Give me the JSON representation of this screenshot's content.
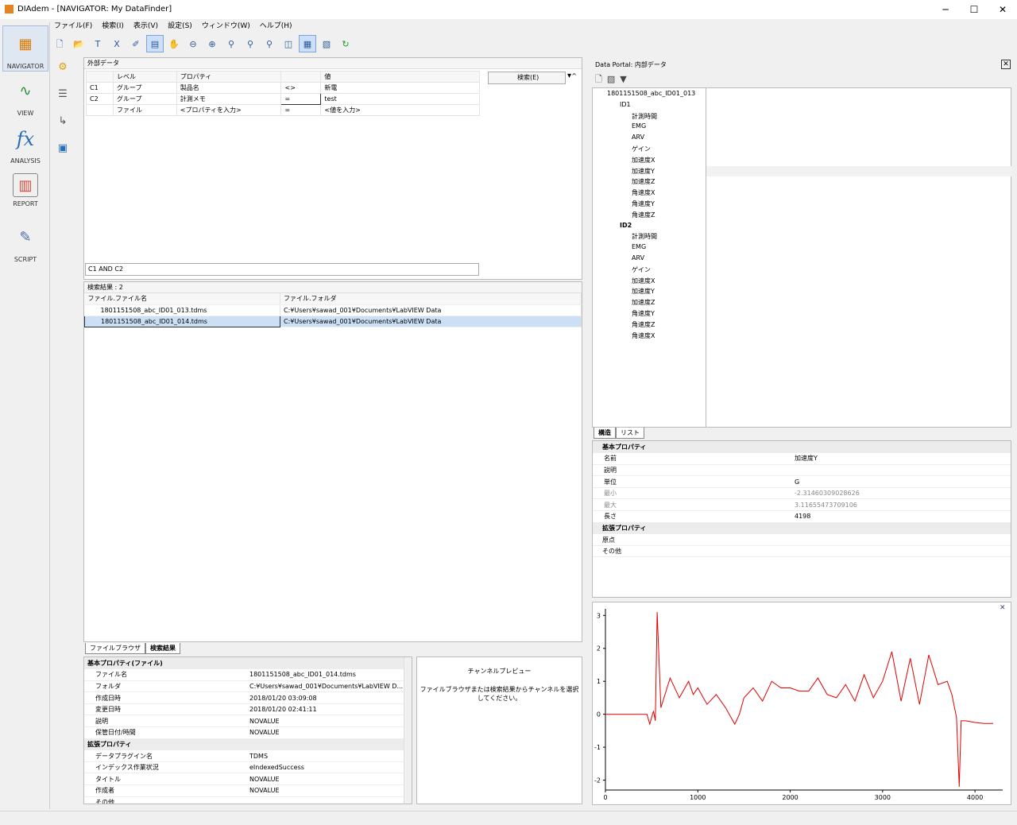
{
  "window": {
    "title": "DIAdem - [NAVIGATOR:  My DataFinder]",
    "min": "─",
    "max": "☐",
    "close": "✕"
  },
  "menu": [
    "ファイル(F)",
    "検索(I)",
    "表示(V)",
    "設定(S)",
    "ウィンドウ(W)",
    "ヘルプ(H)"
  ],
  "sidebar": [
    {
      "label": "NAVIGATOR",
      "icon": "navigator-icon"
    },
    {
      "label": "VIEW",
      "icon": "view-icon"
    },
    {
      "label": "ANALYSIS",
      "icon": "analysis-icon"
    },
    {
      "label": "REPORT",
      "icon": "report-icon"
    },
    {
      "label": "SCRIPT",
      "icon": "script-icon"
    }
  ],
  "query": {
    "title": "外部データ",
    "headers": [
      "レベル",
      "プロパティ",
      "",
      "値"
    ],
    "rows": [
      [
        "C1",
        "グループ",
        "製品名",
        "<>",
        "新電"
      ],
      [
        "C2",
        "グループ",
        "計測メモ",
        "=",
        "test"
      ],
      [
        "",
        "ファイル",
        "<プロパティを入力>",
        "=",
        "<値を入力>"
      ]
    ],
    "search_label": "検索(E)",
    "condition": "C1 AND C2"
  },
  "results": {
    "title": "検索結果 : 2",
    "headers": [
      "ファイル.ファイル名",
      "ファイル.フォルダ"
    ],
    "rows": [
      [
        "1801151508_abc_ID01_013.tdms",
        "C:¥Users¥sawad_001¥Documents¥LabVIEW Data"
      ],
      [
        "1801151508_abc_ID01_014.tdms",
        "C:¥Users¥sawad_001¥Documents¥LabVIEW Data"
      ]
    ],
    "tabs": [
      "ファイルブラウザ",
      "検索結果"
    ]
  },
  "file_props": {
    "sections": [
      {
        "name": "基本プロパティ(ファイル)",
        "items": [
          [
            "ファイル名",
            "1801151508_abc_ID01_014.tdms"
          ],
          [
            "フォルダ",
            "C:¥Users¥sawad_001¥Documents¥LabVIEW D..."
          ],
          [
            "作成日時",
            "2018/01/20 03:09:08"
          ],
          [
            "変更日時",
            "2018/01/20 02:41:11"
          ],
          [
            "説明",
            "NOVALUE"
          ],
          [
            "保管日付/時間",
            "NOVALUE"
          ]
        ]
      },
      {
        "name": "拡張プロパティ",
        "items": [
          [
            "データプラグイン名",
            "TDMS"
          ],
          [
            "インデックス作業状況",
            "eIndexedSuccess"
          ],
          [
            "タイトル",
            "NOVALUE"
          ],
          [
            "作成者",
            "NOVALUE"
          ],
          [
            "その他",
            ""
          ]
        ]
      }
    ]
  },
  "preview": {
    "title": "チャンネルプレビュー",
    "text": "ファイルブラウザまたは検索結果からチャンネルを選択してください。"
  },
  "portal": {
    "title": "Data Portal: 内部データ",
    "root": "1801151508_abc_ID01_013",
    "groups": [
      {
        "name": "ID1",
        "channels": [
          "計測時間",
          "EMG",
          "ARV",
          "ゲイン",
          "加速度X",
          "加速度Y",
          "加速度Z",
          "角速度X",
          "角速度Y",
          "角速度Z"
        ]
      },
      {
        "name": "ID2",
        "channels": [
          "計測時間",
          "EMG",
          "ARV",
          "ゲイン",
          "加速度X",
          "加速度Y",
          "加速度Z",
          "角速度Y",
          "角速度Z",
          "角速度X"
        ]
      }
    ],
    "tabs": [
      "構造",
      "リスト"
    ]
  },
  "channel_props": {
    "basic": "基本プロパティ",
    "items": [
      [
        "名前",
        "加速度Y"
      ],
      [
        "説明",
        ""
      ],
      [
        "単位",
        "G"
      ],
      [
        "最小",
        "-2.31460309028626"
      ],
      [
        "最大",
        "3.11655473709106"
      ],
      [
        "長さ",
        "4198"
      ]
    ],
    "ext": "拡張プロパティ",
    "ext_items": [
      "原点",
      "その他"
    ]
  },
  "chart_data": {
    "type": "line",
    "series": [
      {
        "color": "#e00000",
        "x": [
          0,
          450,
          480,
          500,
          520,
          540,
          560,
          600,
          700,
          800,
          900,
          950,
          1000,
          1100,
          1200,
          1300,
          1400,
          1450,
          1500,
          1600,
          1700,
          1800,
          1900,
          2000,
          2100,
          2200,
          2300,
          2400,
          2500,
          2600,
          2700,
          2800,
          2900,
          3000,
          3100,
          3200,
          3300,
          3400,
          3500,
          3600,
          3700,
          3750,
          3800,
          3830,
          3850,
          3900,
          4000,
          4100,
          4198
        ],
        "y": [
          0,
          0,
          -0.3,
          -0.1,
          0.1,
          -0.2,
          3.1,
          0.2,
          1.1,
          0.5,
          1.0,
          0.6,
          0.8,
          0.3,
          0.6,
          0.2,
          -0.3,
          0.0,
          0.5,
          0.8,
          0.4,
          1.0,
          0.8,
          0.8,
          0.7,
          0.7,
          1.1,
          0.6,
          0.5,
          0.9,
          0.4,
          1.2,
          0.5,
          1.0,
          1.9,
          0.4,
          1.7,
          0.3,
          1.8,
          0.9,
          1.0,
          0.6,
          -0.1,
          -2.2,
          -0.2,
          -0.2,
          -0.25,
          -0.28,
          -0.28
        ]
      }
    ],
    "xlim": [
      0,
      4300
    ],
    "ylim": [
      -2.3,
      3.2
    ],
    "xticks": [
      0,
      1000,
      2000,
      3000,
      4000
    ],
    "yticks": [
      3,
      2,
      1,
      0,
      -1,
      -2
    ]
  },
  "status": ""
}
